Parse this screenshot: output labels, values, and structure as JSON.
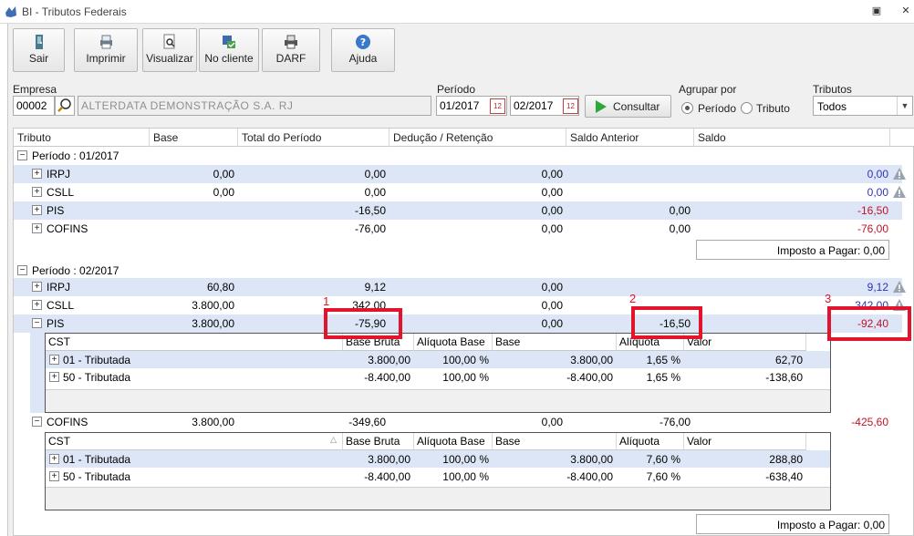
{
  "window": {
    "title": "BI - Tributos Federais"
  },
  "toolbar": [
    {
      "label": "Sair",
      "icon": "door-exit-icon"
    },
    {
      "label": "Imprimir",
      "icon": "printer-icon"
    },
    {
      "label": "Visualizar",
      "icon": "preview-icon"
    },
    {
      "label": "No cliente",
      "icon": "client-data-icon"
    },
    {
      "label": "DARF",
      "icon": "darf-print-icon"
    },
    {
      "label": "Ajuda",
      "icon": "help-icon"
    }
  ],
  "filters": {
    "empresa_label": "Empresa",
    "empresa_code": "00002",
    "empresa_name": "ALTERDATA DEMONSTRAÇÃO S.A. RJ",
    "periodo_label": "Período",
    "periodo_inicio": "01/2017",
    "periodo_fim": "02/2017",
    "consultar_label": "Consultar",
    "agrupar_label": "Agrupar por",
    "agrupar_periodo": "Período",
    "agrupar_tributo": "Tributo",
    "agrupar_selected": "Período",
    "tributos_label": "Tributos",
    "tributos_value": "Todos"
  },
  "grid": {
    "columns": [
      "Tributo",
      "Base",
      "Total do Período",
      "Dedução / Retenção",
      "Saldo Anterior",
      "Saldo"
    ],
    "periods": [
      {
        "title": "Período : 01/2017",
        "rows": [
          {
            "tributo": "IRPJ",
            "base": "0,00",
            "total": "0,00",
            "deducao": "0,00",
            "saldo_anterior": "",
            "saldo": "0,00",
            "saldo_color": "blue",
            "warning": true
          },
          {
            "tributo": "CSLL",
            "base": "0,00",
            "total": "0,00",
            "deducao": "0,00",
            "saldo_anterior": "",
            "saldo": "0,00",
            "saldo_color": "blue",
            "warning": true
          },
          {
            "tributo": "PIS",
            "base": "",
            "total": "-16,50",
            "deducao": "0,00",
            "saldo_anterior": "0,00",
            "saldo": "-16,50",
            "saldo_color": "red",
            "warning": false
          },
          {
            "tributo": "COFINS",
            "base": "",
            "total": "-76,00",
            "deducao": "0,00",
            "saldo_anterior": "0,00",
            "saldo": "-76,00",
            "saldo_color": "red",
            "warning": false
          }
        ],
        "imposto_a_pagar": "Imposto a Pagar: 0,00"
      },
      {
        "title": "Período : 02/2017",
        "rows": [
          {
            "tributo": "IRPJ",
            "base": "60,80",
            "total": "9,12",
            "deducao": "0,00",
            "saldo_anterior": "",
            "saldo": "9,12",
            "saldo_color": "blue",
            "warning": true
          },
          {
            "tributo": "CSLL",
            "base": "3.800,00",
            "total": "342,00",
            "deducao": "0,00",
            "saldo_anterior": "",
            "saldo": "342,00",
            "saldo_color": "blue",
            "warning": true
          },
          {
            "tributo": "PIS",
            "base": "3.800,00",
            "total": "-75,90",
            "deducao": "0,00",
            "saldo_anterior": "-16,50",
            "saldo": "-92,40",
            "saldo_color": "red",
            "warning": false
          },
          {
            "tributo": "COFINS",
            "base": "3.800,00",
            "total": "-349,60",
            "deducao": "0,00",
            "saldo_anterior": "-76,00",
            "saldo": "-425,60",
            "saldo_color": "red",
            "warning": false
          }
        ],
        "imposto_a_pagar": "Imposto a Pagar: 0,00"
      }
    ],
    "detail_columns": [
      "CST",
      "Base Bruta",
      "Alíquota Base",
      "Base",
      "Alíquota",
      "Valor"
    ],
    "pis_detail": [
      {
        "cst": "01 - Tributada",
        "base_bruta": "3.800,00",
        "aliquota_base": "100,00 %",
        "base": "3.800,00",
        "aliquota": "1,65 %",
        "valor": "62,70"
      },
      {
        "cst": "50 - Tributada",
        "base_bruta": "-8.400,00",
        "aliquota_base": "100,00 %",
        "base": "-8.400,00",
        "aliquota": "1,65 %",
        "valor": "-138,60"
      }
    ],
    "cofins_detail": [
      {
        "cst": "01 - Tributada",
        "base_bruta": "3.800,00",
        "aliquota_base": "100,00 %",
        "base": "3.800,00",
        "aliquota": "7,60 %",
        "valor": "288,80"
      },
      {
        "cst": "50 - Tributada",
        "base_bruta": "-8.400,00",
        "aliquota_base": "100,00 %",
        "base": "-8.400,00",
        "aliquota": "7,60 %",
        "valor": "-638,40"
      }
    ]
  },
  "annotations": [
    "1",
    "2",
    "3"
  ],
  "colors": {
    "saldo_blue": "#2c35b8",
    "saldo_red": "#c0122a",
    "selection": "#dde6f6",
    "annotation": "#e2142b"
  }
}
